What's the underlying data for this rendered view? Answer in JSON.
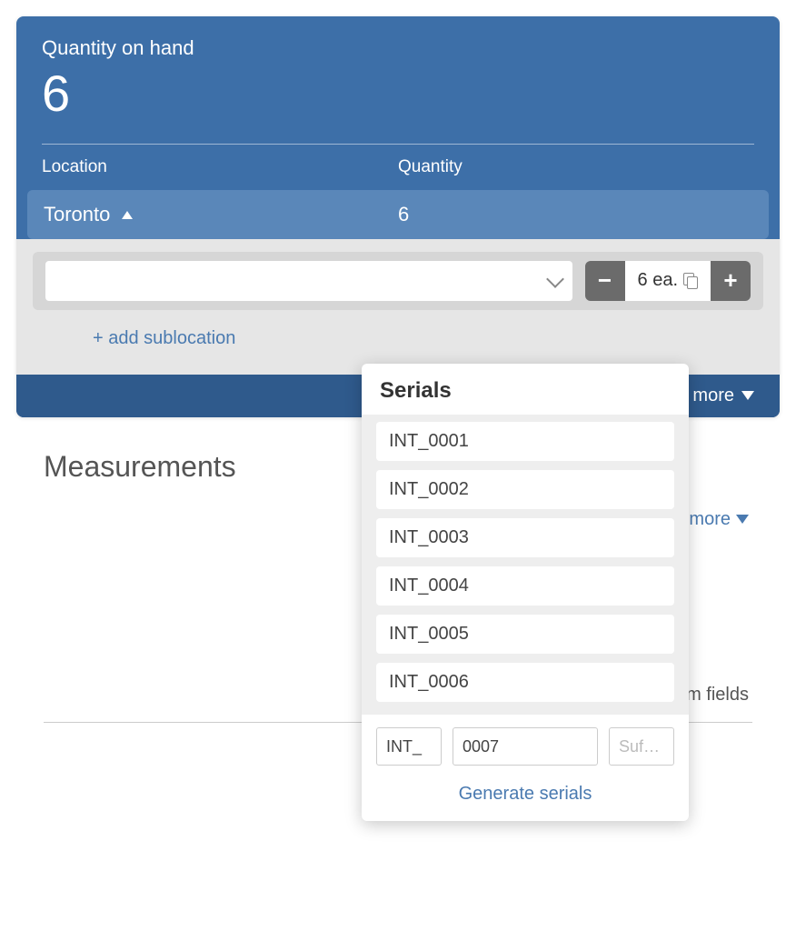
{
  "qoh": {
    "label": "Quantity on hand",
    "value": "6"
  },
  "tableHeaders": {
    "location": "Location",
    "quantity": "Quantity"
  },
  "locationRow": {
    "name": "Toronto",
    "qty": "6"
  },
  "stepper": {
    "display": "6 ea."
  },
  "addSublocation": "+ add sublocation",
  "showMore1": "Show more",
  "serialsPopover": {
    "title": "Serials",
    "items": [
      "INT_0001",
      "INT_0002",
      "INT_0003",
      "INT_0004",
      "INT_0005",
      "INT_0006"
    ],
    "prefix": "INT_",
    "number": "0007",
    "suffixPlaceholder": "Suf…",
    "generate": "Generate serials"
  },
  "measurements": {
    "title": "Measurements",
    "showMore": "Show more"
  },
  "customFields": "+ add custom fields"
}
